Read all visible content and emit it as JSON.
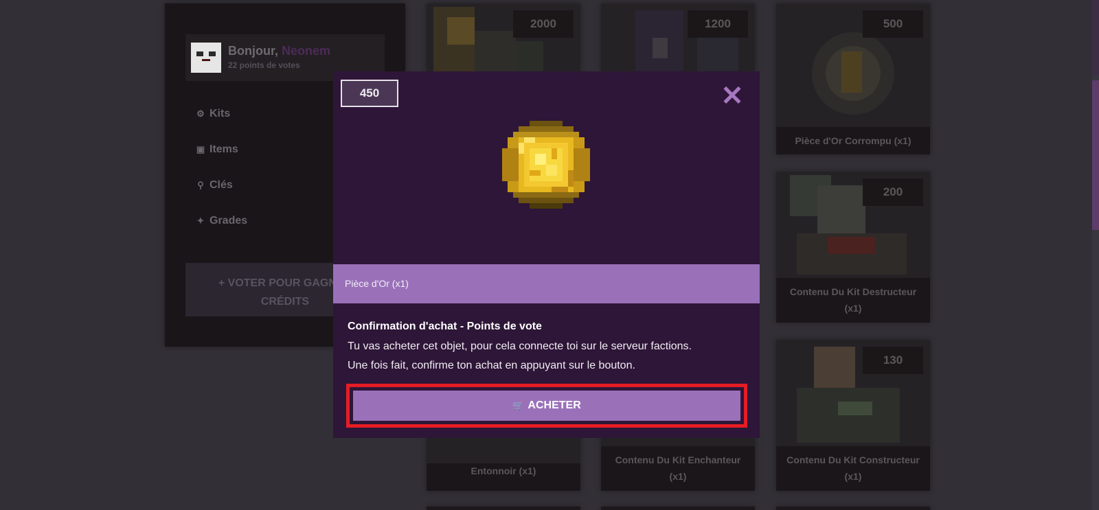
{
  "sidebar": {
    "greeting": "Bonjour,",
    "username": "Neonem",
    "vote_points": "22 points de votes",
    "menu": [
      {
        "label": "Kits",
        "icon": "award-icon"
      },
      {
        "label": "Items",
        "icon": "briefcase-icon"
      },
      {
        "label": "Clés",
        "icon": "key-icon"
      },
      {
        "label": "Grades",
        "icon": "magic-wand-icon"
      }
    ],
    "vote_button_line1": "+ VOTER POUR GAGNER",
    "vote_button_line2": "CRÉDITS"
  },
  "shop": {
    "cards": [
      {
        "price": "2000",
        "label": ""
      },
      {
        "price": "1200",
        "label": ""
      },
      {
        "price": "500",
        "label": "Pièce d'Or Corrompu (x1)"
      },
      {
        "price": "200",
        "label": "Contenu Du Kit Destructeur (x1)"
      },
      {
        "price": "",
        "label": "Entonnoir (x1)"
      },
      {
        "price": "",
        "label": "Contenu Du Kit Enchanteur (x1)"
      },
      {
        "price": "130",
        "label": "Contenu Du Kit Constructeur (x1)"
      }
    ]
  },
  "modal": {
    "price": "450",
    "close_icon": "close-icon",
    "item_name": "Pièce d'Or (x1)",
    "confirm_title": "Confirmation d'achat - Points de vote",
    "confirm_line1": "Tu vas acheter cet objet, pour cela connecte toi sur le serveur factions.",
    "confirm_line2": "Une fois fait, confirme ton achat en appuyant sur le bouton.",
    "buy_label": "ACHETER",
    "buy_icon": "cart-icon"
  },
  "colors": {
    "accent": "#9a71b9",
    "modal_bg": "#2e1638",
    "highlight": "#e61c24"
  }
}
